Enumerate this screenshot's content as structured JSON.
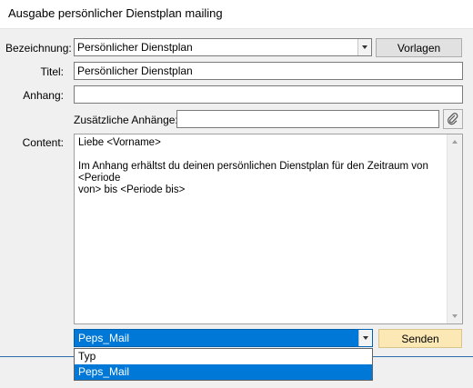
{
  "window": {
    "title": "Ausgabe persönlicher Dienstplan mailing"
  },
  "form": {
    "bezeichnung_label": "Bezeichnung:",
    "bezeichnung_value": "Persönlicher Dienstplan",
    "vorlagen_label": "Vorlagen",
    "titel_label": "Titel:",
    "titel_value": "Persönlicher Dienstplan",
    "anhang_label": "Anhang:",
    "anhang_value": "",
    "zusatz_label": "Zusätzliche Anhänge:",
    "zusatz_value": "",
    "content_label": "Content:",
    "content_value": "Liebe <Vorname>\n\nIm Anhang erhältst du deinen persönlichen Dienstplan für den Zeitraum von <Periode\nvon> bis <Periode bis>"
  },
  "mail": {
    "selected": "Peps_Mail",
    "send_label": "Senden",
    "options": [
      "Typ",
      "Peps_Mail"
    ]
  },
  "colors": {
    "selection": "#0078d7",
    "send_button": "#fbe8b4"
  }
}
